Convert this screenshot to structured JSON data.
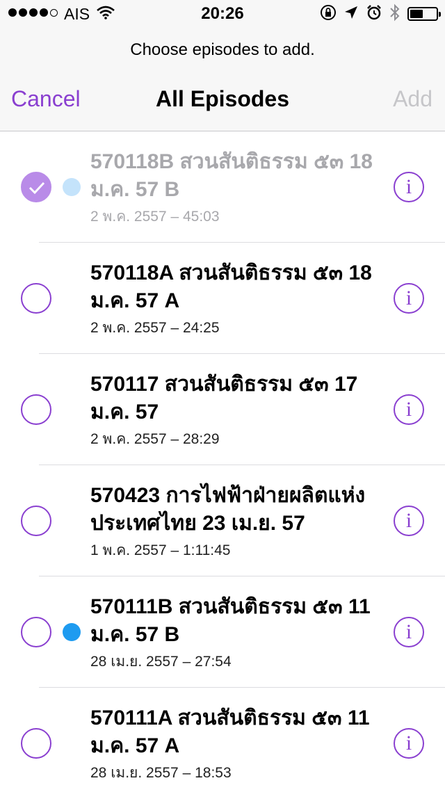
{
  "status_bar": {
    "carrier": "AIS",
    "time": "20:26"
  },
  "header": {
    "prompt": "Choose episodes to add.",
    "cancel_label": "Cancel",
    "title": "All Episodes",
    "add_label": "Add"
  },
  "colors": {
    "accent": "#8a3fd0",
    "unplayed": "#1e9bf0",
    "disabled": "#c6c6c9"
  },
  "episodes": [
    {
      "title": "570118B สวนสันติธรรม ๕๓ 18 ม.ค. 57 B",
      "meta": "2 พ.ค. 2557 – 45:03",
      "selected": true,
      "unplayed": "faded"
    },
    {
      "title": "570118A สวนสันติธรรม ๕๓ 18 ม.ค. 57 A",
      "meta": "2 พ.ค. 2557 – 24:25",
      "selected": false,
      "unplayed": "none"
    },
    {
      "title": "570117 สวนสันติธรรม ๕๓ 17 ม.ค. 57",
      "meta": "2 พ.ค. 2557 – 28:29",
      "selected": false,
      "unplayed": "none"
    },
    {
      "title": "570423 การไฟฟ้าฝ่ายผลิตแห่งประเทศไทย 23 เม.ย. 57",
      "meta": "1 พ.ค. 2557 – 1:11:45",
      "selected": false,
      "unplayed": "none"
    },
    {
      "title": "570111B สวนสันติธรรม ๕๓ 11 ม.ค. 57 B",
      "meta": "28 เม.ย. 2557 – 27:54",
      "selected": false,
      "unplayed": "dot"
    },
    {
      "title": "570111A สวนสันติธรรม ๕๓ 11 ม.ค. 57 A",
      "meta": "28 เม.ย. 2557 – 18:53",
      "selected": false,
      "unplayed": "none"
    }
  ],
  "icons": {
    "info": "i",
    "status": [
      "signal-dots-icon",
      "wifi-icon",
      "orientation-lock-icon",
      "location-icon",
      "alarm-icon",
      "bluetooth-icon",
      "battery-icon"
    ]
  }
}
